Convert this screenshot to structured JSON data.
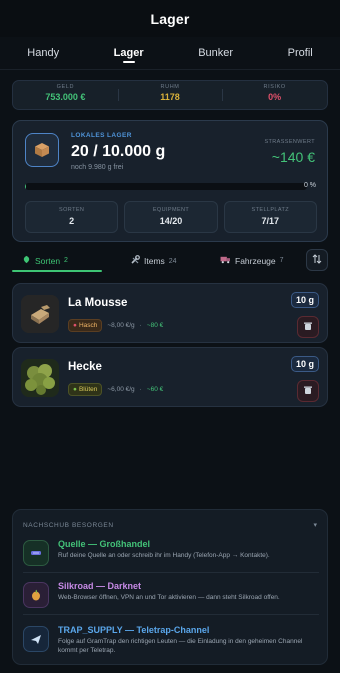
{
  "header": {
    "title": "Lager"
  },
  "nav": {
    "tabs": [
      {
        "label": "Handy"
      },
      {
        "label": "Lager"
      },
      {
        "label": "Bunker"
      },
      {
        "label": "Profil"
      }
    ]
  },
  "stats": {
    "geld": {
      "label": "GELD",
      "value": "753.000 €"
    },
    "ruhm": {
      "label": "RUHM",
      "value": "1178"
    },
    "risiko": {
      "label": "RISIKO",
      "value": "0%"
    }
  },
  "storage": {
    "label": "LOKALES LAGER",
    "amount": "20 / 10.000 g",
    "free": "noch 9.980 g frei",
    "street_value_label": "STRASSENWERT",
    "street_value": "~140 €",
    "progress_pct": "0 %",
    "progress_fraction": 0.002,
    "sorten": {
      "label": "SORTEN",
      "value": "2"
    },
    "equipment": {
      "label": "EQUIPMENT",
      "value": "14/20"
    },
    "stellplatz": {
      "label": "STELLPLATZ",
      "value": "7/17"
    }
  },
  "subtabs": [
    {
      "label": "Sorten",
      "count": "2"
    },
    {
      "label": "Items",
      "count": "24"
    },
    {
      "label": "Fahrzeuge",
      "count": "7"
    }
  ],
  "items": [
    {
      "name": "La Mousse",
      "tag": "Hasch",
      "price": "~8,00 €/g",
      "sep": "·",
      "value": "~80 €",
      "weight": "10 g"
    },
    {
      "name": "Hecke",
      "tag": "Blüten",
      "price": "~6,00 €/g",
      "sep": "·",
      "value": "~60 €",
      "weight": "10 g"
    }
  ],
  "resupply": {
    "title": "NACHSCHUB BESORGEN",
    "sources": [
      {
        "title": "Quelle — Großhandel",
        "desc": "Ruf deine Quelle an oder schreib ihr im Handy (Telefon-App → Kontakte).",
        "color": "#43c278"
      },
      {
        "title": "Silkroad — Darknet",
        "desc": "Web-Browser öffnen, VPN an und Tor aktivieren — dann steht Silkroad offen.",
        "color": "#c78ae6"
      },
      {
        "title": "TRAP_SUPPLY — Teletrap-Channel",
        "desc": "Folge auf GramTrap den richtigen Leuten — die Einladung in den geheimen Channel kommt per Teletrap.",
        "color": "#5aa6ea"
      }
    ]
  },
  "colors": {
    "accent_green": "#43c278",
    "ruhm": "#d8b13a",
    "risiko": "#e0506a",
    "blue": "#4f94d9"
  }
}
